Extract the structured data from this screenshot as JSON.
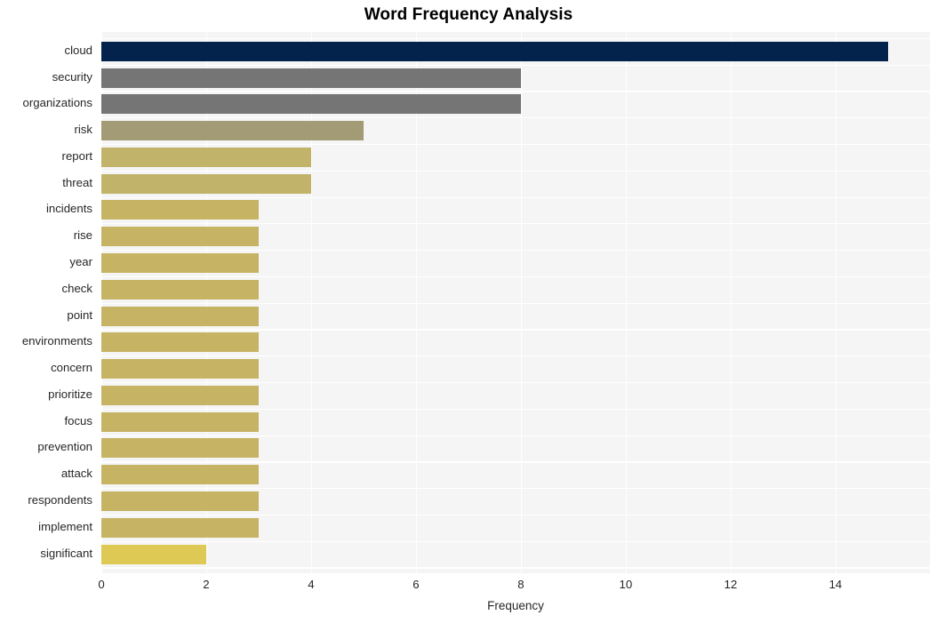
{
  "chart_data": {
    "type": "bar",
    "orientation": "horizontal",
    "title": "Word Frequency Analysis",
    "xlabel": "Frequency",
    "ylabel": "",
    "categories": [
      "cloud",
      "security",
      "organizations",
      "risk",
      "report",
      "threat",
      "incidents",
      "rise",
      "year",
      "check",
      "point",
      "environments",
      "concern",
      "prioritize",
      "focus",
      "prevention",
      "attack",
      "respondents",
      "implement",
      "significant"
    ],
    "values": [
      15,
      8,
      8,
      5,
      4,
      4,
      3,
      3,
      3,
      3,
      3,
      3,
      3,
      3,
      3,
      3,
      3,
      3,
      3,
      2
    ],
    "bar_colors": [
      "#04234c",
      "#757575",
      "#757575",
      "#a39b76",
      "#c2b36a",
      "#c2b36a",
      "#c6b464",
      "#c6b464",
      "#c6b464",
      "#c6b464",
      "#c6b464",
      "#c6b464",
      "#c6b464",
      "#c6b464",
      "#c6b464",
      "#c6b464",
      "#c6b464",
      "#c6b464",
      "#c6b464",
      "#ddc954"
    ],
    "xticks": [
      0,
      2,
      4,
      6,
      8,
      10,
      12,
      14
    ],
    "xtick_labels": [
      "0",
      "2",
      "4",
      "6",
      "8",
      "10",
      "12",
      "14"
    ],
    "xlim": [
      0,
      15.8
    ],
    "grid": true,
    "grid_color": "#ffffff",
    "plot_background": "#f5f5f5",
    "figure_background": "#ffffff",
    "legend": null
  }
}
